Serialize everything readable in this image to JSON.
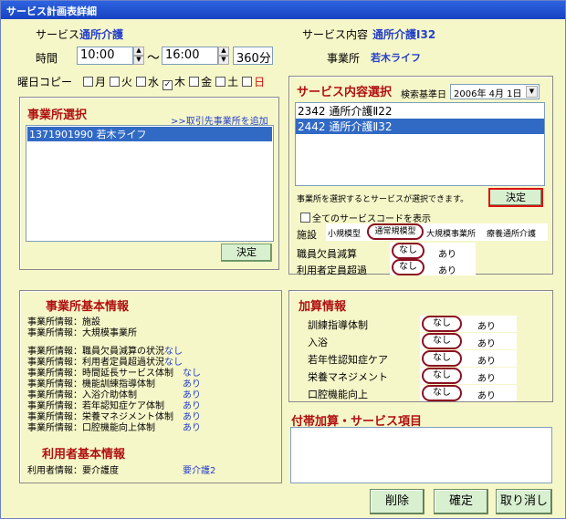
{
  "window": {
    "title": "サービス計画表詳細"
  },
  "header": {
    "service_label": "サービス",
    "service_value": "通所介護",
    "time_label": "時間",
    "time_start": "10:00",
    "tilde": "～",
    "time_end": "16:00",
    "duration": "360分",
    "content_label": "サービス内容",
    "content_value": "通所介護Ⅰ32",
    "office_label": "事業所",
    "office_value": "若木ライフ"
  },
  "weekday": {
    "label": "曜日コピー",
    "days": [
      {
        "label": "月",
        "checked": false
      },
      {
        "label": "火",
        "checked": false
      },
      {
        "label": "水",
        "checked": false
      },
      {
        "label": "木",
        "checked": true
      },
      {
        "label": "金",
        "checked": false
      },
      {
        "label": "土",
        "checked": false
      },
      {
        "label": "日",
        "checked": false
      }
    ]
  },
  "office_select": {
    "title": "事業所選択",
    "link": ">>取引先事業所を追加",
    "items": [
      "1371901990 若木ライフ"
    ],
    "decide": "決定"
  },
  "service_select": {
    "title": "サービス内容選択",
    "date_label": "検索基準日",
    "date_value": "2006年 4月 1日",
    "items": [
      "2342 通所介護Ⅱ22",
      "2442 通所介護Ⅱ32"
    ],
    "hint": "事業所を選択するとサービスが選択できます。",
    "decide": "決定",
    "show_all": "全てのサービスコードを表示",
    "facility_label": "施設",
    "facility_options": [
      "小規模型",
      "通常規模型",
      "大規模事業所",
      "療養通所介護"
    ],
    "staff_label": "職員欠員減算",
    "over_label": "利用者定員超過",
    "none": "なし",
    "yes": "あり"
  },
  "office_info": {
    "title": "事業所基本情報",
    "rows": [
      {
        "k": "事業所情報：施設",
        "v": ""
      },
      {
        "k": "事業所情報：大規模事業所",
        "v": ""
      },
      {
        "k": "事業所情報：職員欠員減算の状況",
        "v": "なし"
      },
      {
        "k": "事業所情報：利用者定員超過状況",
        "v": "なし"
      },
      {
        "k": "事業所情報：時間延長サービス体制",
        "v": "なし"
      },
      {
        "k": "事業所情報：機能訓練指導体制",
        "v": "あり"
      },
      {
        "k": "事業所情報：入浴介助体制",
        "v": "あり"
      },
      {
        "k": "事業所情報：若年認知症ケア体制",
        "v": "あり"
      },
      {
        "k": "事業所情報：栄養マネジメント体制",
        "v": "あり"
      },
      {
        "k": "事業所情報：口腔機能向上体制",
        "v": "あり"
      }
    ]
  },
  "user_info": {
    "title": "利用者基本情報",
    "key": "利用者情報：要介護度",
    "value": "要介護2"
  },
  "addition": {
    "title": "加算情報",
    "rows": [
      "訓練指導体制",
      "入浴",
      "若年性認知症ケア",
      "栄養マネジメント",
      "口腔機能向上"
    ],
    "none": "なし",
    "yes": "あり"
  },
  "extra": {
    "title": "付帯加算・サービス項目"
  },
  "footer": {
    "delete": "削除",
    "confirm": "確定",
    "cancel": "取り消し"
  }
}
